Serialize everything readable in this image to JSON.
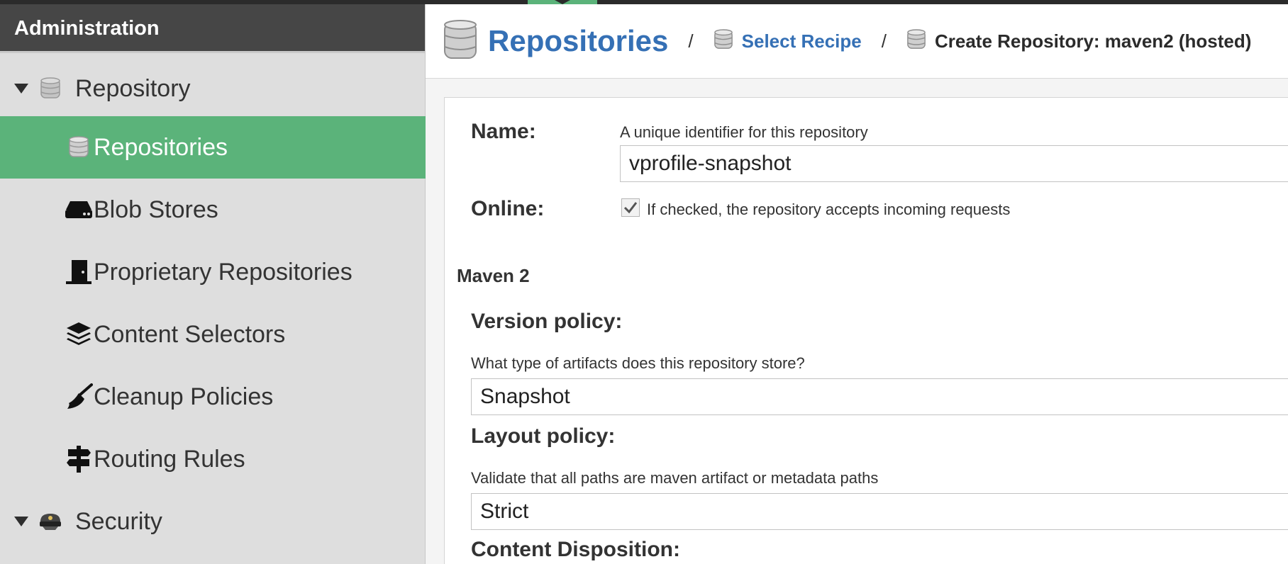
{
  "sidebar": {
    "header": "Administration",
    "group_repository": {
      "label": "Repository",
      "icon": "database-icon"
    },
    "items": [
      {
        "label": "Repositories",
        "icon": "database-icon",
        "selected": true
      },
      {
        "label": "Blob Stores",
        "icon": "hard-drive-icon"
      },
      {
        "label": "Proprietary Repositories",
        "icon": "door-icon"
      },
      {
        "label": "Content Selectors",
        "icon": "layers-icon"
      },
      {
        "label": "Cleanup Policies",
        "icon": "broom-icon"
      },
      {
        "label": "Routing Rules",
        "icon": "signpost-icon"
      }
    ],
    "group_security": {
      "label": "Security",
      "icon": "police-hat-icon"
    }
  },
  "breadcrumb": {
    "root": "Repositories",
    "separator": "/",
    "link": "Select Recipe",
    "current": "Create Repository: maven2 (hosted)"
  },
  "form": {
    "name": {
      "label": "Name:",
      "help": "A unique identifier for this repository",
      "value": "vprofile-snapshot"
    },
    "online": {
      "label": "Online:",
      "checked": true,
      "help": "If checked, the repository accepts incoming requests"
    },
    "section": "Maven 2",
    "version_policy": {
      "label": "Version policy:",
      "help": "What type of artifacts does this repository store?",
      "value": "Snapshot"
    },
    "layout_policy": {
      "label": "Layout policy:",
      "help": "Validate that all paths are maven artifact or metadata paths",
      "value": "Strict"
    },
    "content_disposition": {
      "label": "Content Disposition:"
    }
  },
  "colors": {
    "accent": "#5bb37a",
    "link": "#3570b5",
    "header_bg": "#464646",
    "sidebar_bg": "#dedede"
  }
}
